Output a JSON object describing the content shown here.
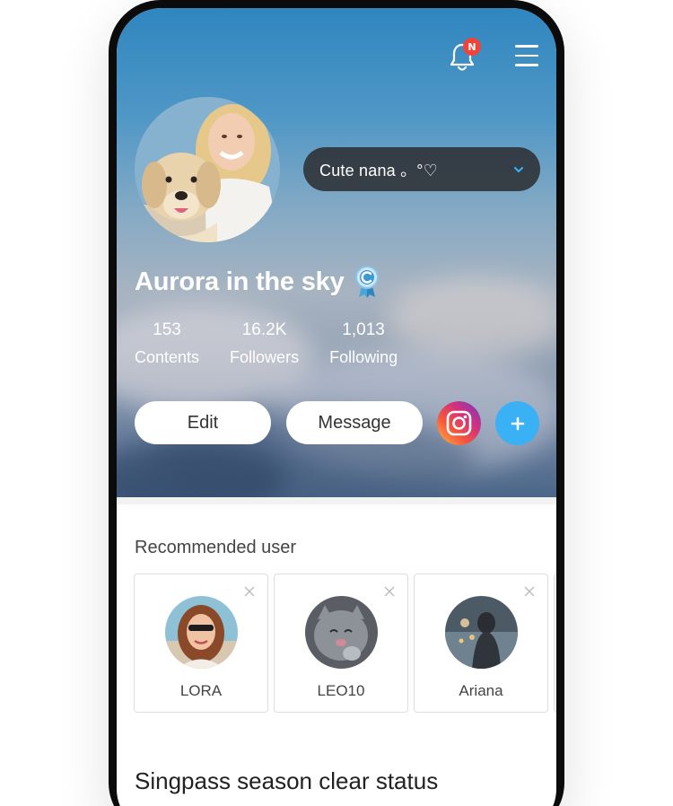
{
  "header": {
    "notification_badge": "N"
  },
  "profile": {
    "status_message": "Cute nana 。°♡",
    "name": "Aurora in the sky",
    "stats": [
      {
        "value": "153",
        "label": "Contents"
      },
      {
        "value": "16.2K",
        "label": "Followers"
      },
      {
        "value": "1,013",
        "label": "Following"
      }
    ],
    "edit_label": "Edit",
    "message_label": "Message"
  },
  "recommended": {
    "title": "Recommended user",
    "users": [
      "LORA",
      "LEO10",
      "Ariana"
    ]
  },
  "season": {
    "title": "Singpass season clear status"
  },
  "colors": {
    "accent": "#39b1f4",
    "badge": "#f0443a",
    "pill_bg": "#2d3034"
  }
}
